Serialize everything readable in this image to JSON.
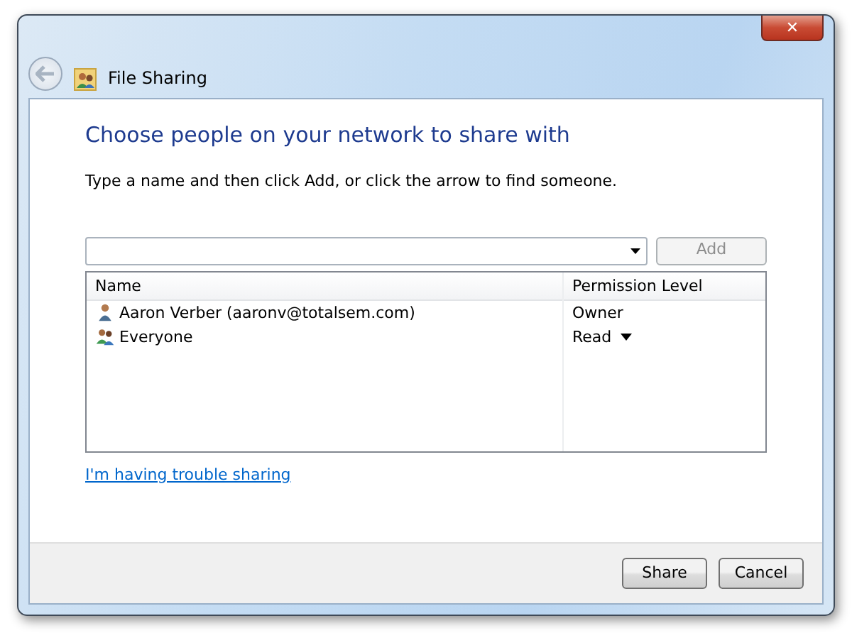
{
  "window": {
    "title": "File Sharing",
    "close": "✕"
  },
  "heading": "Choose people on your network to share with",
  "instruction": "Type a name and then click Add, or click the arrow to find someone.",
  "add_button": {
    "label": "Add",
    "disabled": true
  },
  "table": {
    "columns": [
      "Name",
      "Permission Level"
    ],
    "rows": [
      {
        "name": "Aaron Verber (aaronv@totalsem.com)",
        "kind": "user",
        "permission": "Owner",
        "has_menu": false
      },
      {
        "name": "Everyone",
        "kind": "group",
        "permission": "Read",
        "has_menu": true
      }
    ]
  },
  "help_link": "I'm having trouble sharing",
  "buttons": [
    {
      "label": "Share"
    },
    {
      "label": "Cancel"
    }
  ]
}
